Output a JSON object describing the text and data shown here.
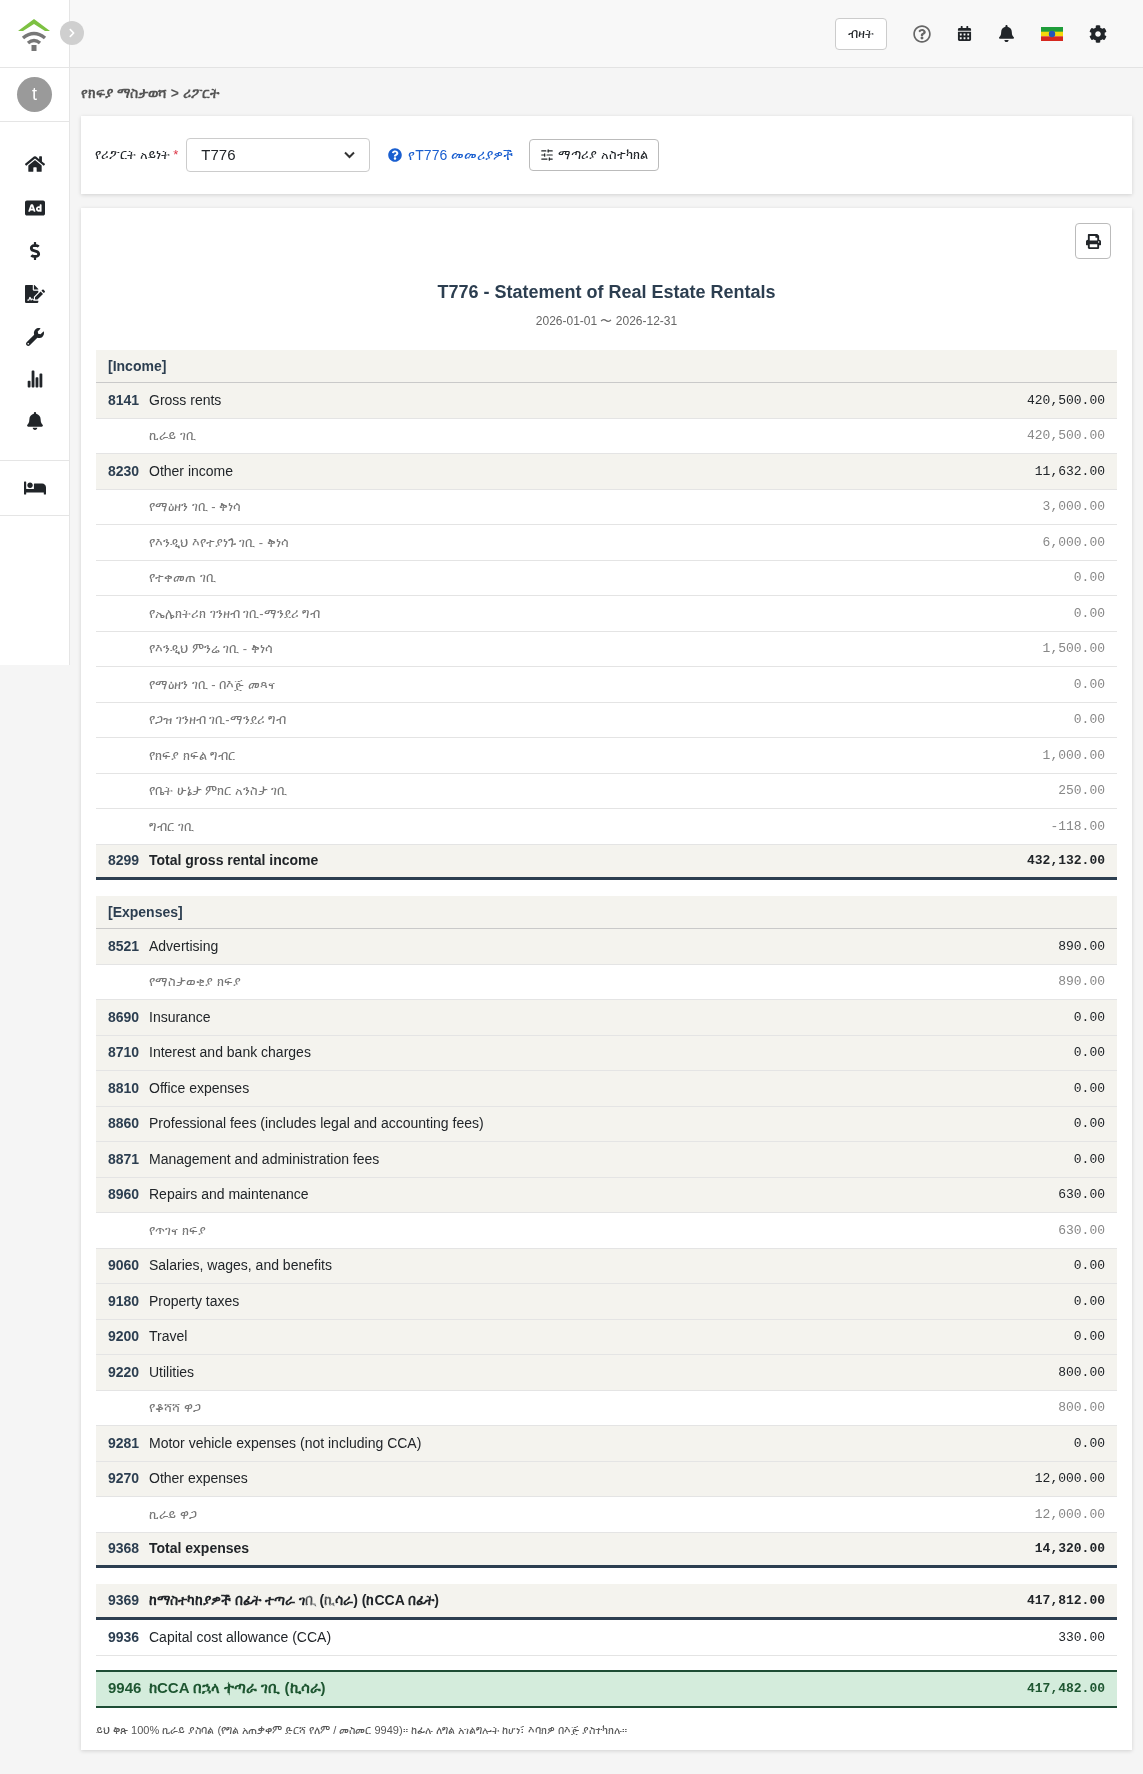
{
  "user": {
    "initial": "t"
  },
  "header": {
    "language_button": "ብዛት"
  },
  "breadcrumb": "የክፍያ ማስታወሻ > ሪፖርት",
  "filter": {
    "label": "የሪፖርት አይነት",
    "required_mark": "*",
    "report_type": "T776",
    "help_link": "የT776 መመሪያዎች",
    "adjust_button": "ማጣሪያ አስተካክል"
  },
  "report": {
    "title": "T776 - Statement of Real Estate Rentals",
    "period": "2026-01-01 〜 2026-12-31",
    "rows": [
      {
        "kind": "section",
        "label": "[Income]"
      },
      {
        "kind": "line",
        "code": "8141",
        "label": "Gross rents",
        "value": "420,500.00"
      },
      {
        "kind": "detail",
        "label": "ኪራይ ገቢ",
        "value": "420,500.00"
      },
      {
        "kind": "line",
        "code": "8230",
        "label": "Other income",
        "value": "11,632.00"
      },
      {
        "kind": "detail",
        "label": "የማዕዘን ገቢ - ቅነሳ",
        "value": "3,000.00"
      },
      {
        "kind": "detail",
        "label": "የእንዲህ እየተያነጉ ገቢ - ቅነሳ",
        "value": "6,000.00"
      },
      {
        "kind": "detail",
        "label": "የተቀመጠ ገቢ",
        "value": "0.00"
      },
      {
        "kind": "detail",
        "label": "የኤሌክትሪክ ገንዘብ ገቢ-ማንደሪ ግብ",
        "value": "0.00"
      },
      {
        "kind": "detail",
        "label": "የእንዲህ ምንሬ ገቢ - ቅነሳ",
        "value": "1,500.00"
      },
      {
        "kind": "detail",
        "label": "የማዕዘን ገቢ - በእጅ መጻና",
        "value": "0.00"
      },
      {
        "kind": "detail",
        "label": "የጋዝ ገንዘብ ገቢ-ማንደሪ ግብ",
        "value": "0.00"
      },
      {
        "kind": "detail",
        "label": "የክፍያ ክፍል ግብር",
        "value": "1,000.00"
      },
      {
        "kind": "detail",
        "label": "የቤት ሁኔታ ምክር አንስታ ገቢ",
        "value": "250.00"
      },
      {
        "kind": "detail",
        "label": "ግብር ገቢ",
        "value": "-118.00"
      },
      {
        "kind": "total",
        "code": "8299",
        "label": "Total gross rental income",
        "value": "432,132.00"
      },
      {
        "kind": "section",
        "label": "[Expenses]"
      },
      {
        "kind": "line",
        "code": "8521",
        "label": "Advertising",
        "value": "890.00"
      },
      {
        "kind": "detail",
        "label": "የማስታወቂያ ክፍያ",
        "value": "890.00"
      },
      {
        "kind": "line",
        "code": "8690",
        "label": "Insurance",
        "value": "0.00"
      },
      {
        "kind": "line",
        "code": "8710",
        "label": "Interest and bank charges",
        "value": "0.00"
      },
      {
        "kind": "line",
        "code": "8810",
        "label": "Office expenses",
        "value": "0.00"
      },
      {
        "kind": "line",
        "code": "8860",
        "label": "Professional fees (includes legal and accounting fees)",
        "value": "0.00"
      },
      {
        "kind": "line",
        "code": "8871",
        "label": "Management and administration fees",
        "value": "0.00"
      },
      {
        "kind": "line",
        "code": "8960",
        "label": "Repairs and maintenance",
        "value": "630.00"
      },
      {
        "kind": "detail",
        "label": "የጥገና ክፍያ",
        "value": "630.00"
      },
      {
        "kind": "line",
        "code": "9060",
        "label": "Salaries, wages, and benefits",
        "value": "0.00"
      },
      {
        "kind": "line",
        "code": "9180",
        "label": "Property taxes",
        "value": "0.00"
      },
      {
        "kind": "line",
        "code": "9200",
        "label": "Travel",
        "value": "0.00"
      },
      {
        "kind": "line",
        "code": "9220",
        "label": "Utilities",
        "value": "800.00"
      },
      {
        "kind": "detail",
        "label": "የቆሻሻ ዋጋ",
        "value": "800.00"
      },
      {
        "kind": "line",
        "code": "9281",
        "label": "Motor vehicle expenses (not including CCA)",
        "value": "0.00"
      },
      {
        "kind": "line",
        "code": "9270",
        "label": "Other expenses",
        "value": "12,000.00"
      },
      {
        "kind": "detail",
        "label": "ኪራይ ዋጋ",
        "value": "12,000.00"
      },
      {
        "kind": "total",
        "code": "9368",
        "label": "Total expenses",
        "value": "14,320.00"
      },
      {
        "kind": "net",
        "code": "9369",
        "label": "ከማስተካከያዎች በፊት ተጣራ ገቢ (ኪሳራ) (ከCCA በፊት)",
        "value": "417,812.00"
      },
      {
        "kind": "plain",
        "code": "9936",
        "label": "Capital cost allowance (CCA)",
        "value": "330.00"
      },
      {
        "kind": "final",
        "code": "9946",
        "label": "ከCCA በኋላ ተጣራ ገቢ (ኪሳራ)",
        "value": "417,482.00"
      }
    ],
    "note": "ይህ ቅጽ 100% ኪራይ ያስባል (የግል አጠቃቀም ድርሻ የለም / መስመር 9949)። ከፊሉ ለግል አገልግሎት ከሆነ፣ እባክዎ በእጅ ያስተካክሉ።"
  }
}
